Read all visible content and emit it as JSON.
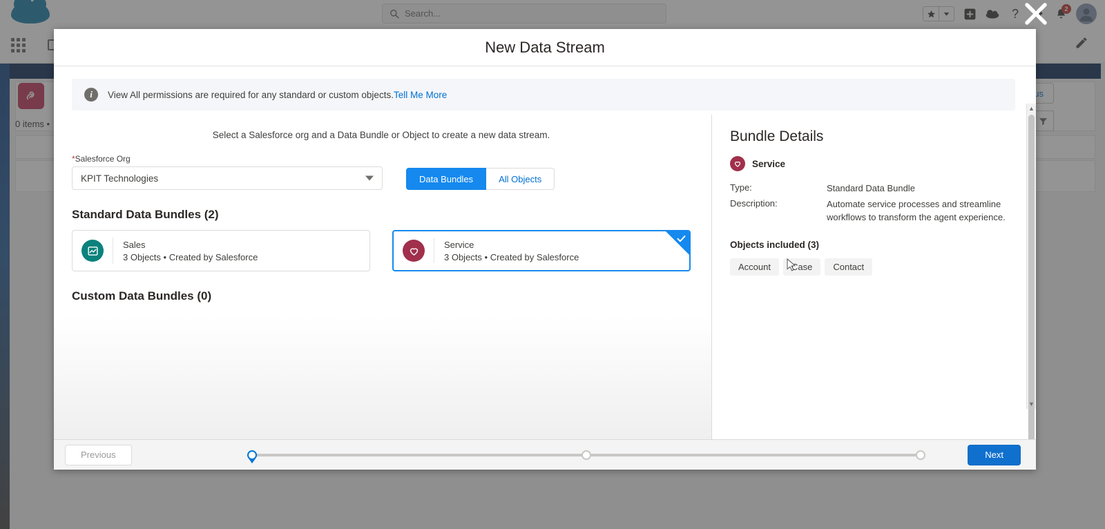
{
  "background": {
    "search": {
      "placeholder": "Search...",
      "icon": "search-icon"
    },
    "icons": {
      "favorites": "star-icon",
      "favorites_caret": "chevron-down-icon",
      "add": "plus-icon",
      "setup_cloud": "cloud-setup-icon",
      "help": "question-mark-icon",
      "settings": "gear-icon",
      "notifications": "bell-icon",
      "notification_count": "2",
      "avatar": "user-avatar",
      "app_launcher": "app-launcher-icon",
      "edit_pencil": "pencil-icon"
    },
    "list_meta": "0 items •",
    "status_button": "Status",
    "refresh_icon": "refresh-icon",
    "filter_icon": "filter-icon",
    "stream_icon": "data-stream-icon"
  },
  "modal": {
    "title": "New Data Stream",
    "banner": {
      "icon": "info-icon",
      "text": "View All permissions are required for any standard or custom objects.",
      "link": "Tell Me More"
    },
    "lead_text": "Select a Salesforce org and a Data Bundle or Object to create a new data stream.",
    "org_field": {
      "label": "Salesforce Org",
      "required_marker": "*",
      "value": "KPIT Technologies",
      "caret_icon": "chevron-down-icon"
    },
    "toggle": {
      "options": [
        "Data Bundles",
        "All Objects"
      ],
      "selected": "Data Bundles"
    },
    "standard_section_title": "Standard Data Bundles (2)",
    "custom_section_title": "Custom Data Bundles (0)",
    "bundles": [
      {
        "name": "Sales",
        "meta": "3 Objects • Created by Salesforce",
        "icon": "sales-chart-icon",
        "icon_color": "#0b827c",
        "selected": false
      },
      {
        "name": "Service",
        "meta": "3 Objects • Created by Salesforce",
        "icon": "service-heart-icon",
        "icon_color": "#a0304c",
        "selected": true,
        "check_icon": "check-icon"
      }
    ],
    "details": {
      "heading": "Bundle Details",
      "name": "Service",
      "icon": "service-heart-icon",
      "icon_color": "#a0304c",
      "type_label": "Type:",
      "type_value": "Standard Data Bundle",
      "description_label": "Description:",
      "description_value": "Automate service processes and streamline workflows to transform the agent experience.",
      "objects_title": "Objects included (3)",
      "objects": [
        "Account",
        "Case",
        "Contact"
      ]
    },
    "footer": {
      "previous_label": "Previous",
      "next_label": "Next",
      "total_steps": 3,
      "active_step": 1
    }
  },
  "colors": {
    "accent_blue": "#1589ee",
    "primary_button": "#1070ce",
    "link": "#0070d2",
    "sales_teal": "#0b827c",
    "service_maroon": "#a0304c",
    "badge_red": "#c23934"
  }
}
